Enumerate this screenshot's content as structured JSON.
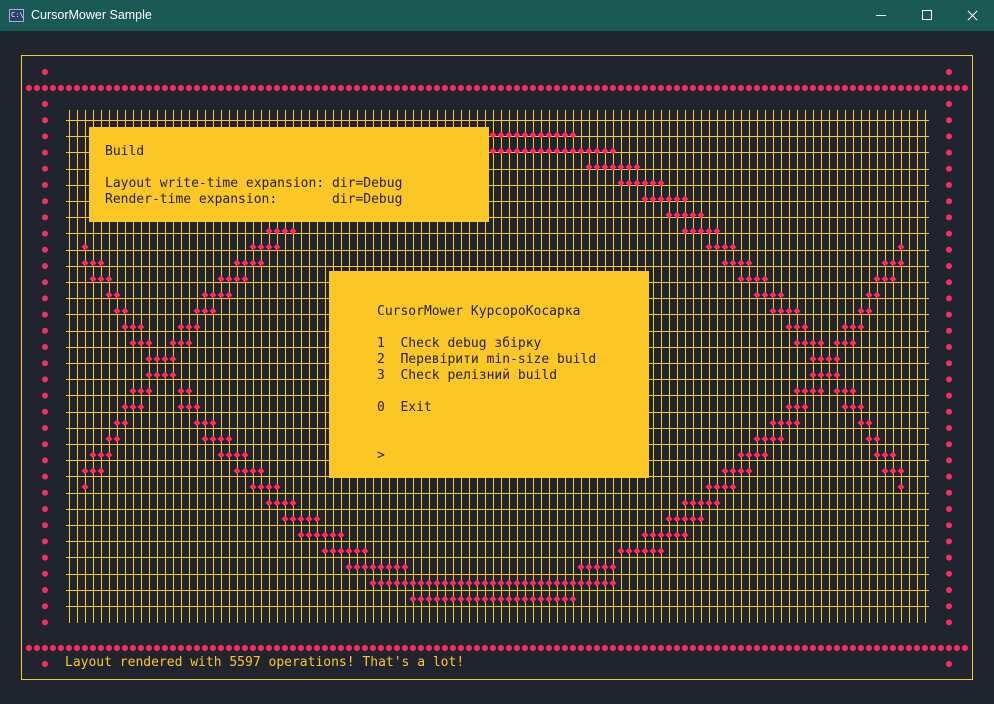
{
  "window": {
    "title": "CursorMower Sample",
    "icon": "console-icon",
    "icon_text": "C:\\",
    "controls": [
      "minimize",
      "maximize",
      "close"
    ]
  },
  "colors": {
    "background": "#20242e",
    "accent_yellow": "#fdc826",
    "dot_pink": "#ff2a62",
    "titlebar": "#1a5a55",
    "panel_text": "#21242c"
  },
  "build_panel": {
    "heading": "Build",
    "line1": "Layout write-time expansion: dir=Debug",
    "line2": "Render-time expansion:       dir=Debug"
  },
  "menu_panel": {
    "title": "CursorMower КурсороКосарка",
    "items": [
      {
        "key": "1",
        "label": "Check debug збірку"
      },
      {
        "key": "2",
        "label": "Перевірити min-size build"
      },
      {
        "key": "3",
        "label": "Check релізний build"
      },
      {
        "key": "0",
        "label": "Exit"
      }
    ],
    "prompt": ">"
  },
  "status": {
    "text": "Layout rendered with 5597 operations! That's a lot!"
  }
}
